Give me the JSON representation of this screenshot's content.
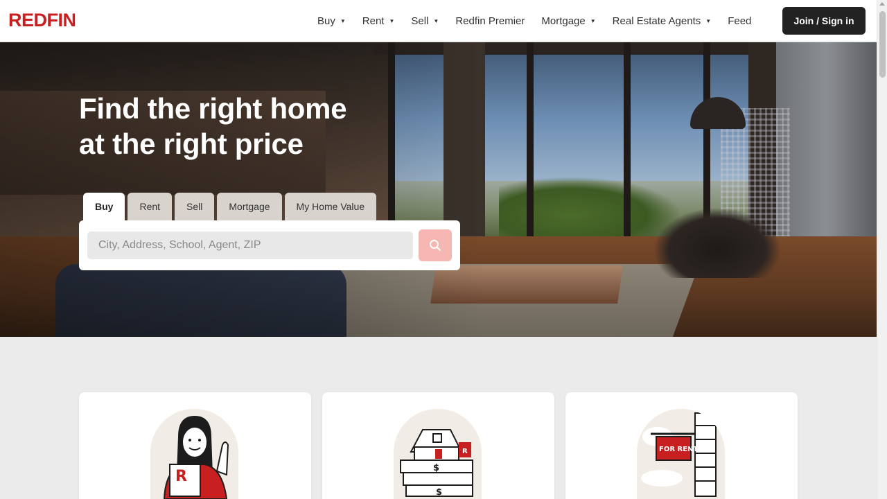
{
  "header": {
    "logo": "REDFIN",
    "nav": [
      {
        "label": "Buy",
        "has_caret": true
      },
      {
        "label": "Rent",
        "has_caret": true
      },
      {
        "label": "Sell",
        "has_caret": true
      },
      {
        "label": "Redfin Premier",
        "has_caret": false
      },
      {
        "label": "Mortgage",
        "has_caret": true
      },
      {
        "label": "Real Estate Agents",
        "has_caret": true
      },
      {
        "label": "Feed",
        "has_caret": false
      }
    ],
    "join_label": "Join / Sign in"
  },
  "hero": {
    "title_line1": "Find the right home",
    "title_line2": "at the right price",
    "tabs": [
      {
        "label": "Buy",
        "active": true
      },
      {
        "label": "Rent",
        "active": false
      },
      {
        "label": "Sell",
        "active": false
      },
      {
        "label": "Mortgage",
        "active": false
      },
      {
        "label": "My Home Value",
        "active": false
      }
    ],
    "search": {
      "placeholder": "City, Address, School, Agent, ZIP",
      "button_icon": "search-icon"
    }
  },
  "cards": [
    {
      "illustration": "agent-waving-illustration"
    },
    {
      "illustration": "house-on-money-illustration"
    },
    {
      "illustration": "for-rent-sign-illustration",
      "sign_text": "FOR RENT"
    }
  ],
  "colors": {
    "brand": "#c82021",
    "join_button": "#222222",
    "search_button": "#f6b7b2",
    "page_background": "#ebebeb"
  }
}
